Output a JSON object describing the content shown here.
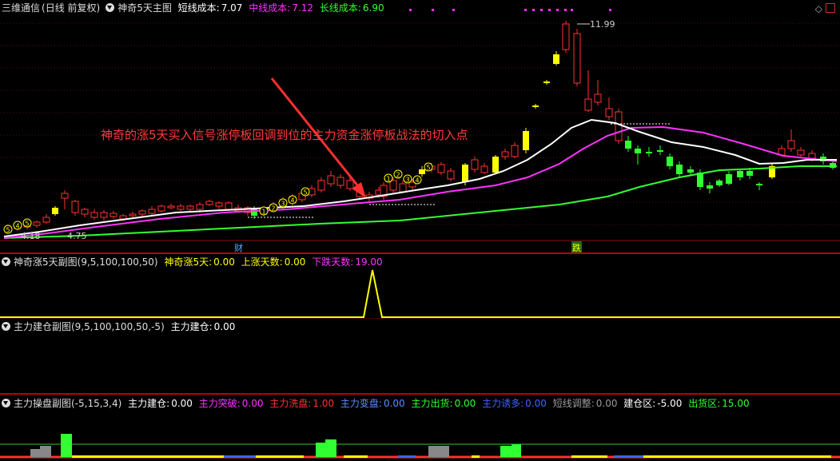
{
  "main": {
    "stock": "三维通信",
    "period": "(日线 前复权)",
    "indicator": "神奇5天主图",
    "short_cost_label": "短线成本:",
    "short_cost_value": "7.07",
    "mid_cost_label": "中线成本:",
    "mid_cost_value": "7.12",
    "long_cost_label": "长线成本:",
    "long_cost_value": "6.90",
    "annotation": "神奇的涨5天买入信号涨停板回调到位的主力资金涨停板战法的切入点",
    "high_label": "11.99",
    "low_label": "4.75",
    "low_label_left": "4.18",
    "tag_cai": "财",
    "tag_die": "跌",
    "nav_icon": "diamond-icon",
    "colors": {
      "up": "#ff3232",
      "down": "#54fcfc",
      "green": "#32ff32",
      "magenta": "#ff32ff",
      "yellow": "#ffff00"
    }
  },
  "sub1": {
    "title": "神奇涨5天副图(9,5,100,100,50)",
    "f1_label": "神奇涨5天:",
    "f1_value": "0.00",
    "f2_label": "上涨天数:",
    "f2_value": "0.00",
    "f3_label": "下跌天数:",
    "f3_value": "19.00"
  },
  "sub2": {
    "title": "主力建仓副图(9,5,100,100,50,-5)",
    "f1_label": "主力建仓:",
    "f1_value": "0.00"
  },
  "sub3": {
    "title": "主力操盘副图(-5,15,3,4)",
    "f1_label": "主力建仓:",
    "f1_value": "0.00",
    "f2_label": "主力突破:",
    "f2_value": "0.00",
    "f3_label": "主力洗盘:",
    "f3_value": "1.00",
    "f4_label": "主力变盘:",
    "f4_value": "0.00",
    "f5_label": "主力出货:",
    "f5_value": "0.00",
    "f6_label": "主力诱多:",
    "f6_value": "0.00",
    "f7_label": "短线调整:",
    "f7_value": "0.00",
    "f8_label": "建仓区:",
    "f8_value": "-5.00",
    "f9_label": "出货区:",
    "f9_value": "15.00"
  }
}
